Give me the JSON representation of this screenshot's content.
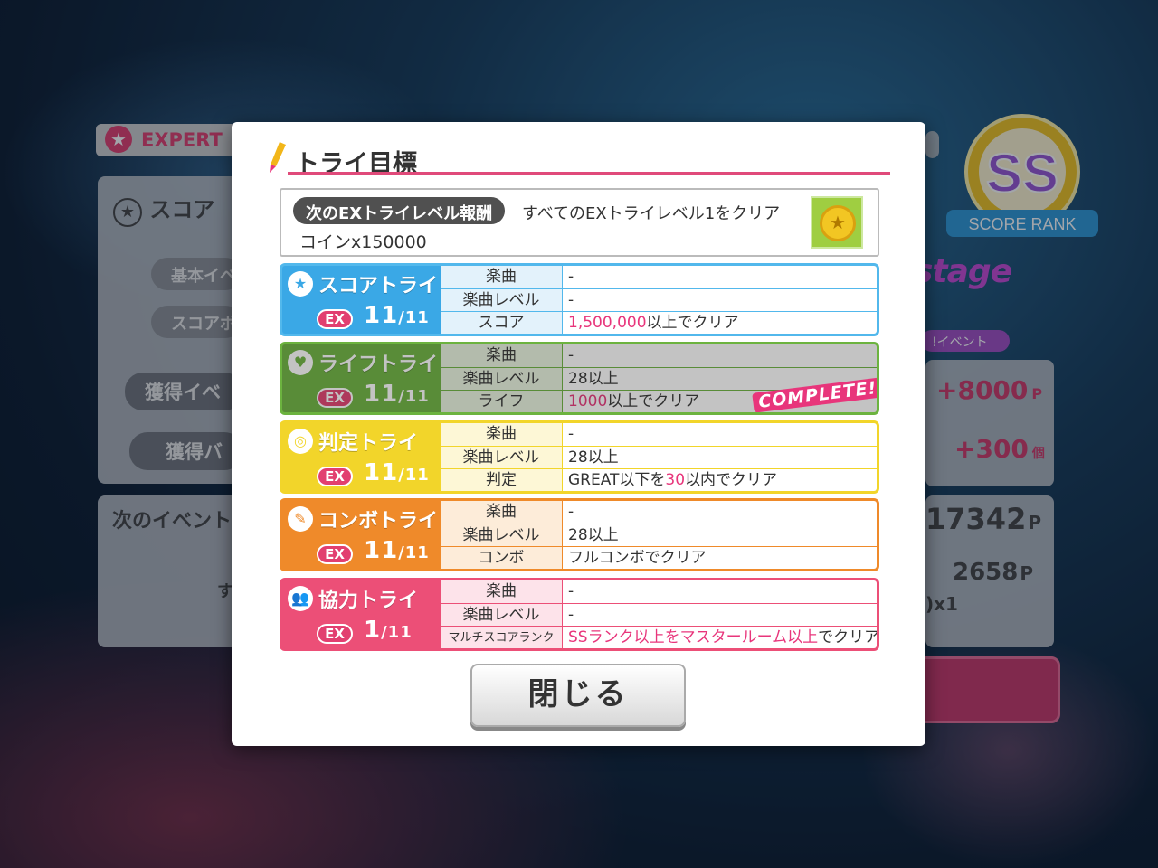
{
  "background": {
    "expert_tab": "EXPERT",
    "score_label": "スコア",
    "base_event": "基本イベ",
    "score_bonus": "スコアボ",
    "earned_event": "獲得イベ",
    "earned_badge": "獲得バ",
    "next_event": "次のイベント",
    "points_plus": "+8000",
    "points_unit": "P",
    "badge_plus": "+300",
    "badge_unit": "個",
    "total_points": "17342",
    "total_unit": "P",
    "next_points": "2658",
    "next_unit": "P",
    "reward_multiplier": ")x1",
    "stage_logo": "stage",
    "event_tag": "!イベント",
    "rank": "SS",
    "rank_label": "SCORE RANK"
  },
  "modal": {
    "title": "トライ目標",
    "reward": {
      "pill": "次のEXトライレベル報酬",
      "condition": "すべてのEXトライレベル1をクリア",
      "item": "コインx150000",
      "icon": "coin-icon"
    },
    "tries": [
      {
        "name": "スコアトライ",
        "icon": "star-icon",
        "ex": "EX",
        "progress": "11",
        "total": "/11",
        "colors": {
          "head": "#3aa8e6",
          "border": "#52b8ec",
          "label_bg": "#e3f2fb"
        },
        "dimmed": false,
        "complete": "",
        "rows": [
          {
            "label": "楽曲",
            "value": "-",
            "hl": "",
            "tail": ""
          },
          {
            "label": "楽曲レベル",
            "value": "-",
            "hl": "",
            "tail": ""
          },
          {
            "label": "スコア",
            "value": "",
            "hl": "1,500,000",
            "tail": "以上でクリア"
          }
        ]
      },
      {
        "name": "ライフトライ",
        "icon": "heart-icon",
        "ex": "EX",
        "progress": "11",
        "total": "/11",
        "colors": {
          "head": "#6cb33f",
          "border": "#6cb33f",
          "label_bg": "#e9f4df"
        },
        "dimmed": true,
        "complete": "COMPLETE!",
        "rows": [
          {
            "label": "楽曲",
            "value": "-",
            "hl": "",
            "tail": ""
          },
          {
            "label": "楽曲レベル",
            "value": "28以上",
            "hl": "",
            "tail": ""
          },
          {
            "label": "ライフ",
            "value": "",
            "hl": "1000",
            "tail": "以上でクリア"
          }
        ]
      },
      {
        "name": "判定トライ",
        "icon": "target-icon",
        "ex": "EX",
        "progress": "11",
        "total": "/11",
        "colors": {
          "head": "#f2d52a",
          "border": "#f2d52a",
          "label_bg": "#fdf7d6"
        },
        "dimmed": false,
        "complete": "",
        "rows": [
          {
            "label": "楽曲",
            "value": "-",
            "hl": "",
            "tail": ""
          },
          {
            "label": "楽曲レベル",
            "value": "28以上",
            "hl": "",
            "tail": ""
          },
          {
            "label": "判定",
            "value": "GREAT以下を",
            "hl": "30",
            "tail": "以内でクリア"
          }
        ]
      },
      {
        "name": "コンボトライ",
        "icon": "brush-icon",
        "ex": "EX",
        "progress": "11",
        "total": "/11",
        "colors": {
          "head": "#ef8a2a",
          "border": "#ef8a2a",
          "label_bg": "#fdecd9"
        },
        "dimmed": false,
        "complete": "",
        "rows": [
          {
            "label": "楽曲",
            "value": "-",
            "hl": "",
            "tail": ""
          },
          {
            "label": "楽曲レベル",
            "value": "28以上",
            "hl": "",
            "tail": ""
          },
          {
            "label": "コンボ",
            "value": "フルコンボでクリア",
            "hl": "",
            "tail": ""
          }
        ]
      },
      {
        "name": "協力トライ",
        "icon": "people-icon",
        "ex": "EX",
        "progress": "1",
        "total": "/11",
        "colors": {
          "head": "#ec4f77",
          "border": "#ec4f77",
          "label_bg": "#fde3ea"
        },
        "dimmed": false,
        "complete": "",
        "rows": [
          {
            "label": "楽曲",
            "value": "-",
            "hl": "",
            "tail": ""
          },
          {
            "label": "楽曲レベル",
            "value": "-",
            "hl": "",
            "tail": ""
          },
          {
            "label": "マルチスコアランク",
            "value": "",
            "hl": "SSランク以上を",
            "tail": "",
            "extra_hl": "マスタールーム以上",
            "extra_tail": "でクリア"
          }
        ]
      }
    ],
    "close_label": "閉じる"
  }
}
